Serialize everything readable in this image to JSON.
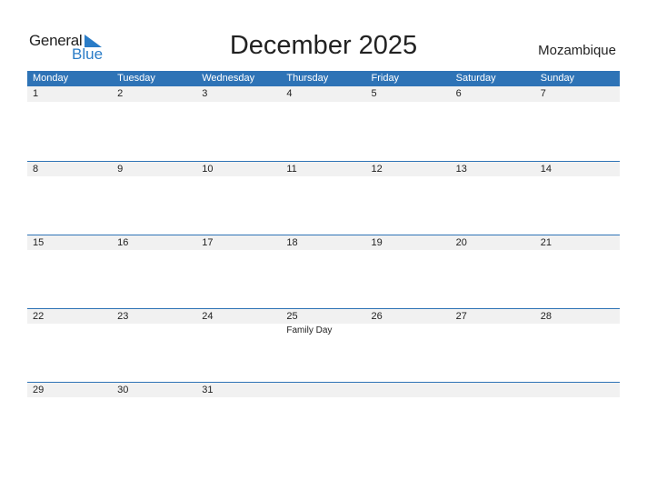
{
  "logo": {
    "word1": "General",
    "word2": "Blue"
  },
  "title": "December 2025",
  "country": "Mozambique",
  "colors": {
    "header_bg": "#2e73b6",
    "date_bar_bg": "#f1f1f1",
    "logo_blue": "#2a7cc7"
  },
  "weekdays": [
    "Monday",
    "Tuesday",
    "Wednesday",
    "Thursday",
    "Friday",
    "Saturday",
    "Sunday"
  ],
  "weeks": [
    {
      "days": [
        "1",
        "2",
        "3",
        "4",
        "5",
        "6",
        "7"
      ],
      "events": [
        "",
        "",
        "",
        "",
        "",
        "",
        ""
      ]
    },
    {
      "days": [
        "8",
        "9",
        "10",
        "11",
        "12",
        "13",
        "14"
      ],
      "events": [
        "",
        "",
        "",
        "",
        "",
        "",
        ""
      ]
    },
    {
      "days": [
        "15",
        "16",
        "17",
        "18",
        "19",
        "20",
        "21"
      ],
      "events": [
        "",
        "",
        "",
        "",
        "",
        "",
        ""
      ]
    },
    {
      "days": [
        "22",
        "23",
        "24",
        "25",
        "26",
        "27",
        "28"
      ],
      "events": [
        "",
        "",
        "",
        "Family Day",
        "",
        "",
        ""
      ]
    },
    {
      "days": [
        "29",
        "30",
        "31",
        "",
        "",
        "",
        ""
      ],
      "events": [
        "",
        "",
        "",
        "",
        "",
        "",
        ""
      ]
    }
  ]
}
